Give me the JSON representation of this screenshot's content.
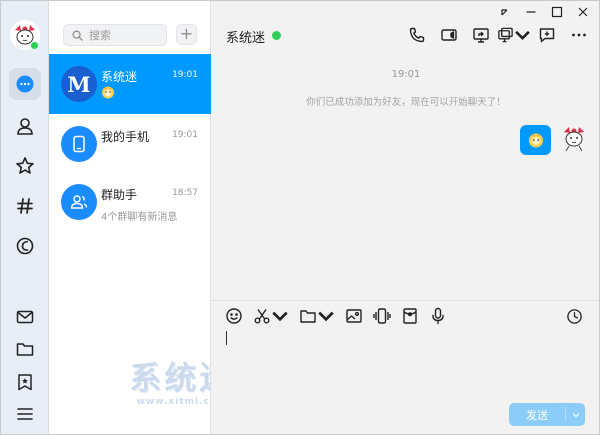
{
  "sidebar": {
    "icons": [
      "avatar",
      "chat-bubble-icon",
      "contacts-icon",
      "star-icon",
      "channel-hash-icon",
      "space-icon",
      "mail-icon",
      "folder-icon",
      "bookmark-icon",
      "menu-icon"
    ],
    "active": "chat-bubble-icon"
  },
  "search": {
    "placeholder": "搜索",
    "add_label": "+"
  },
  "conversations": [
    {
      "name": "系统迷",
      "time": "19:01",
      "preview": "",
      "avatar_letter": "M",
      "active": true
    },
    {
      "name": "我的手机",
      "time": "19:01",
      "preview": "",
      "avatar_icon": "phone-icon"
    },
    {
      "name": "群助手",
      "time": "18:57",
      "preview": "4个群聊有新消息",
      "avatar_icon": "group-icon"
    }
  ],
  "watermark": {
    "main": "系统迷",
    "sub": "www.xitmi.com"
  },
  "chat": {
    "title": "系统迷",
    "timestamp": "19:01",
    "system_message": "你们已成功添加为好友，现在可以开始聊天了！",
    "send_label": "发送"
  },
  "colors": {
    "accent": "#0099ff",
    "online": "#2fd05a",
    "send_disabled": "#8cccf9"
  }
}
